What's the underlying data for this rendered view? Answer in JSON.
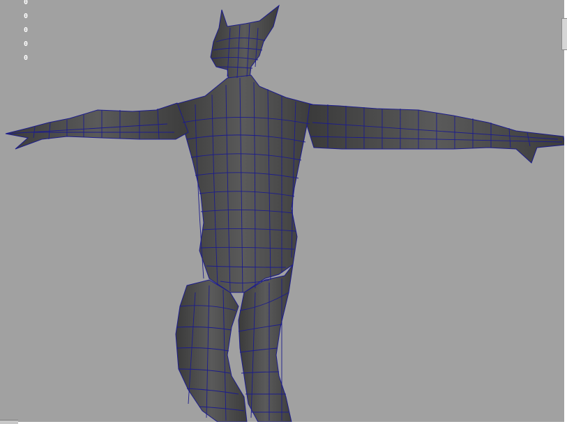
{
  "viewport": {
    "background": "#a1a1a1",
    "mesh_fill": "#4a4a4a",
    "wire_color": "#1c1c8c",
    "hud_values": [
      "0",
      "0",
      "0",
      "0",
      "0"
    ]
  },
  "model": {
    "description_icon": "creature-mesh-icon"
  }
}
